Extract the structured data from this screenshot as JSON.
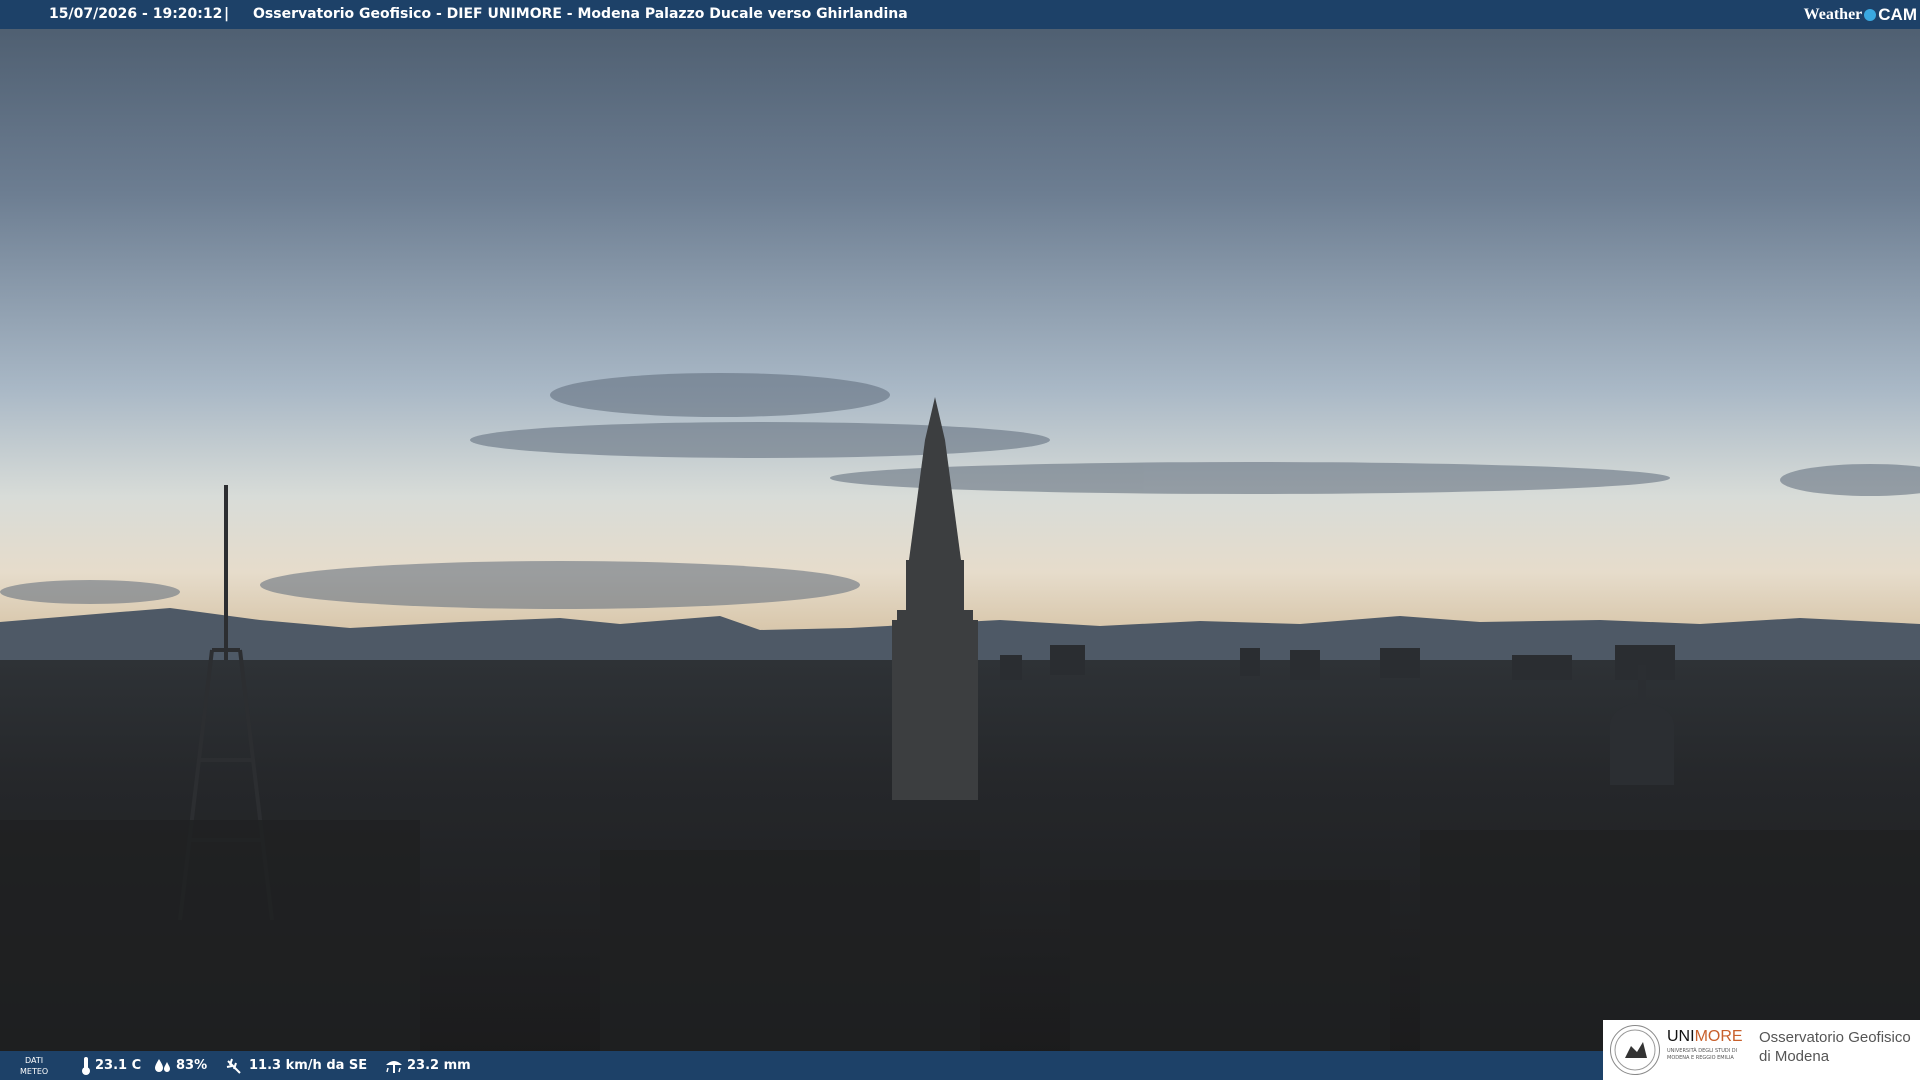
{
  "header": {
    "timestamp": "15/07/2026 - 19:20:12",
    "separator": "|",
    "caption": "Osservatorio Geofisico - DIEF UNIMORE - Modena Palazzo Ducale verso Ghirlandina",
    "brand_weather": "Weather",
    "brand_cam": "CAM"
  },
  "weather": {
    "label_line1": "DATI",
    "label_line2": "METEO",
    "temperature": "23.1 C",
    "humidity": "83%",
    "wind": "11.3 km/h da SE",
    "rain": "23.2 mm"
  },
  "logo": {
    "uni_a": "UNI",
    "uni_b": "MORE",
    "uni_sub": "UNIVERSITÀ DEGLI STUDI DI MODENA E REGGIO EMILIA",
    "org_line1": "Osservatorio Geofisico",
    "org_line2": "di Modena"
  },
  "colors": {
    "bar": "#1d4168",
    "accent": "#c8602c",
    "brand_dot": "#3aa8e0"
  },
  "icons": [
    "thermometer-icon",
    "humidity-drops-icon",
    "wind-icon",
    "rain-gauge-icon",
    "weathercam-dot-icon",
    "university-seal-icon"
  ]
}
